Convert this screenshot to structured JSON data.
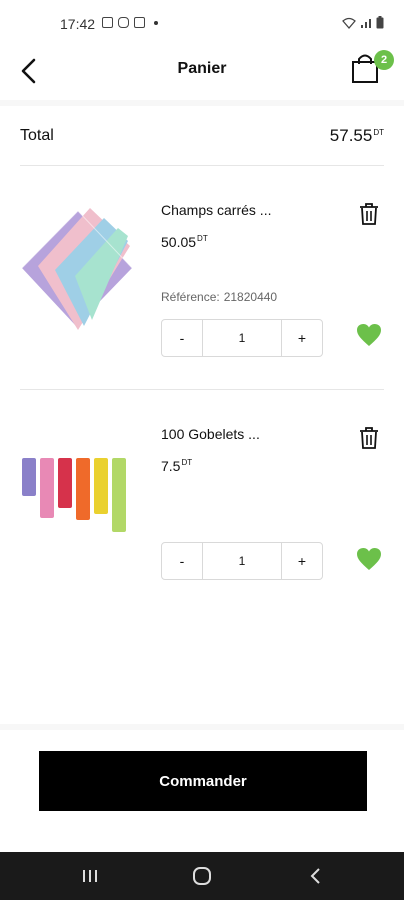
{
  "status_bar": {
    "time": "17:42"
  },
  "header": {
    "title": "Panier",
    "cart_count": "2"
  },
  "total": {
    "label": "Total",
    "amount": "57.55",
    "currency": "DT"
  },
  "items": [
    {
      "name": "Champs carrés ...",
      "price": "50.05",
      "currency": "DT",
      "reference_label": "Référence:",
      "reference_value": "21820440",
      "quantity": "1",
      "minus": "-",
      "plus": "+"
    },
    {
      "name": "100 Gobelets ...",
      "price": "7.5",
      "currency": "DT",
      "quantity": "1",
      "minus": "-",
      "plus": "+"
    }
  ],
  "order_button": {
    "label": "Commander"
  },
  "colors": {
    "accent_green": "#6cc04a",
    "button_black": "#000000"
  },
  "icons": [
    "back-arrow-icon",
    "cart-icon",
    "trash-icon",
    "heart-icon"
  ]
}
